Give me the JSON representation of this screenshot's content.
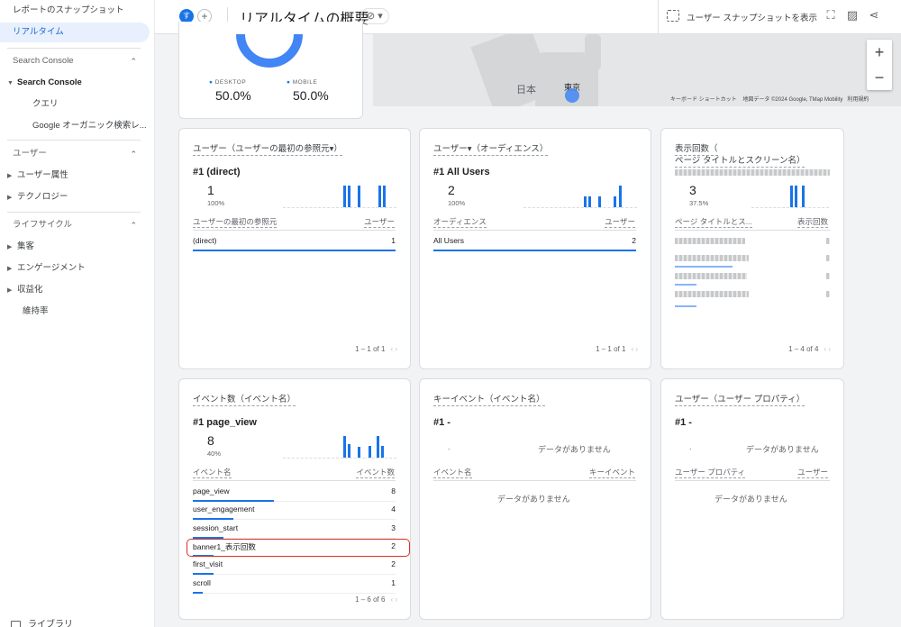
{
  "sidebar": {
    "items": [
      {
        "label": "レポートのスナップショット"
      },
      {
        "label": "リアルタイム"
      }
    ],
    "sections": [
      {
        "label": "Search Console",
        "children": [
          "Search Console",
          "クエリ",
          "Google オーガニック検索レ..."
        ]
      },
      {
        "label": "ユーザー",
        "children": [
          "ユーザー属性",
          "テクノロジー"
        ]
      },
      {
        "label": "ライフサイクル",
        "children": [
          "集客",
          "エンゲージメント",
          "収益化",
          "維持率"
        ]
      }
    ],
    "library": "ライブラリ"
  },
  "header": {
    "avatar_letter": "す",
    "plus": "+",
    "title": "リアルタイムの概要",
    "status_icon": "⊘ ▾",
    "snapshot_label": "ユーザー スナップショットを表示"
  },
  "device_card": {
    "desktop_label": "DESKTOP",
    "desktop_value": "50.0%",
    "mobile_label": "MOBILE",
    "mobile_value": "50.0%"
  },
  "map": {
    "label_japan": "日本",
    "label_tokyo": "東京",
    "attribution": [
      "キーボード ショートカット",
      "地図データ ©2024 Google, TMap Mobility",
      "利用規約"
    ],
    "zoom_in": "+",
    "zoom_out": "−"
  },
  "cards": {
    "users_source": {
      "title": "ユーザー（ユーザーの最初の参照元▾）",
      "rank": "#1  (direct)",
      "value": "1",
      "pct": "100%",
      "col1": "ユーザーの最初の参照元",
      "col2": "ユーザー",
      "rows": [
        {
          "name": "(direct)",
          "value": "1",
          "share": 1.0
        }
      ],
      "pager": "1 – 1 of 1"
    },
    "users_audience": {
      "title": "ユーザー▾（オーディエンス）",
      "rank": "#1  All Users",
      "value": "2",
      "pct": "100%",
      "col1": "オーディエンス",
      "col2": "ユーザー",
      "rows": [
        {
          "name": "All Users",
          "value": "2",
          "share": 1.0
        }
      ],
      "pager": "1 – 1 of 1"
    },
    "views": {
      "title1": "表示回数（",
      "title2": "ページ タイトルとスクリーン名）",
      "value": "3",
      "pct": "37.5%",
      "col1": "ページ タイトルとス...",
      "col2": "表示回数",
      "pager": "1 – 4 of 4"
    },
    "events": {
      "title": "イベント数（イベント名）",
      "rank": "#1  page_view",
      "value": "8",
      "pct": "40%",
      "col1": "イベント名",
      "col2": "イベント数",
      "rows": [
        {
          "name": "page_view",
          "value": "8",
          "share": 1.0
        },
        {
          "name": "user_engagement",
          "value": "4",
          "share": 0.5
        },
        {
          "name": "session_start",
          "value": "3",
          "share": 0.375
        },
        {
          "name": "banner1_表示回数",
          "value": "2",
          "share": 0.25
        },
        {
          "name": "first_visit",
          "value": "2",
          "share": 0.25
        },
        {
          "name": "scroll",
          "value": "1",
          "share": 0.125
        }
      ],
      "pager": "1 – 6 of 6"
    },
    "key_events": {
      "title": "キーイベント（イベント名）",
      "rank": "#1  -",
      "dot": ".",
      "nodata": "データがありません",
      "col1": "イベント名",
      "col2": "キーイベント",
      "nodata2": "データがありません"
    },
    "user_props": {
      "title": "ユーザー（ユーザー プロパティ）",
      "rank": "#1  -",
      "dot": ".",
      "nodata": "データがありません",
      "col1": "ユーザー プロパティ",
      "col2": "ユーザー",
      "nodata2": "データがありません"
    }
  },
  "pager_arrows": "‹  ›"
}
